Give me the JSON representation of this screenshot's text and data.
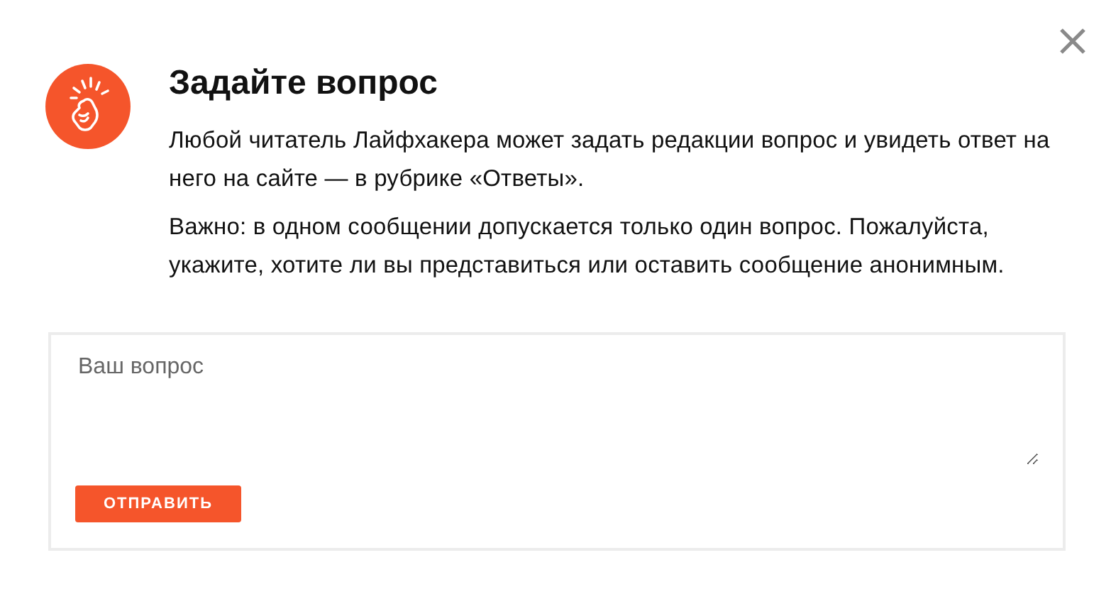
{
  "dialog": {
    "title": "Задайте вопрос",
    "paragraphs": [
      "Любой читатель Лайфхакера может задать редакции вопрос и увидеть ответ на него на сайте — в рубрике «Ответы».",
      "Важно: в одном сообщении допускается только один вопрос. Пожалуйста, укажите, хотите ли вы представиться или оставить сообщение анонимным."
    ],
    "question_field": {
      "placeholder": "Ваш вопрос"
    },
    "submit_button": "ОТПРАВИТЬ"
  }
}
